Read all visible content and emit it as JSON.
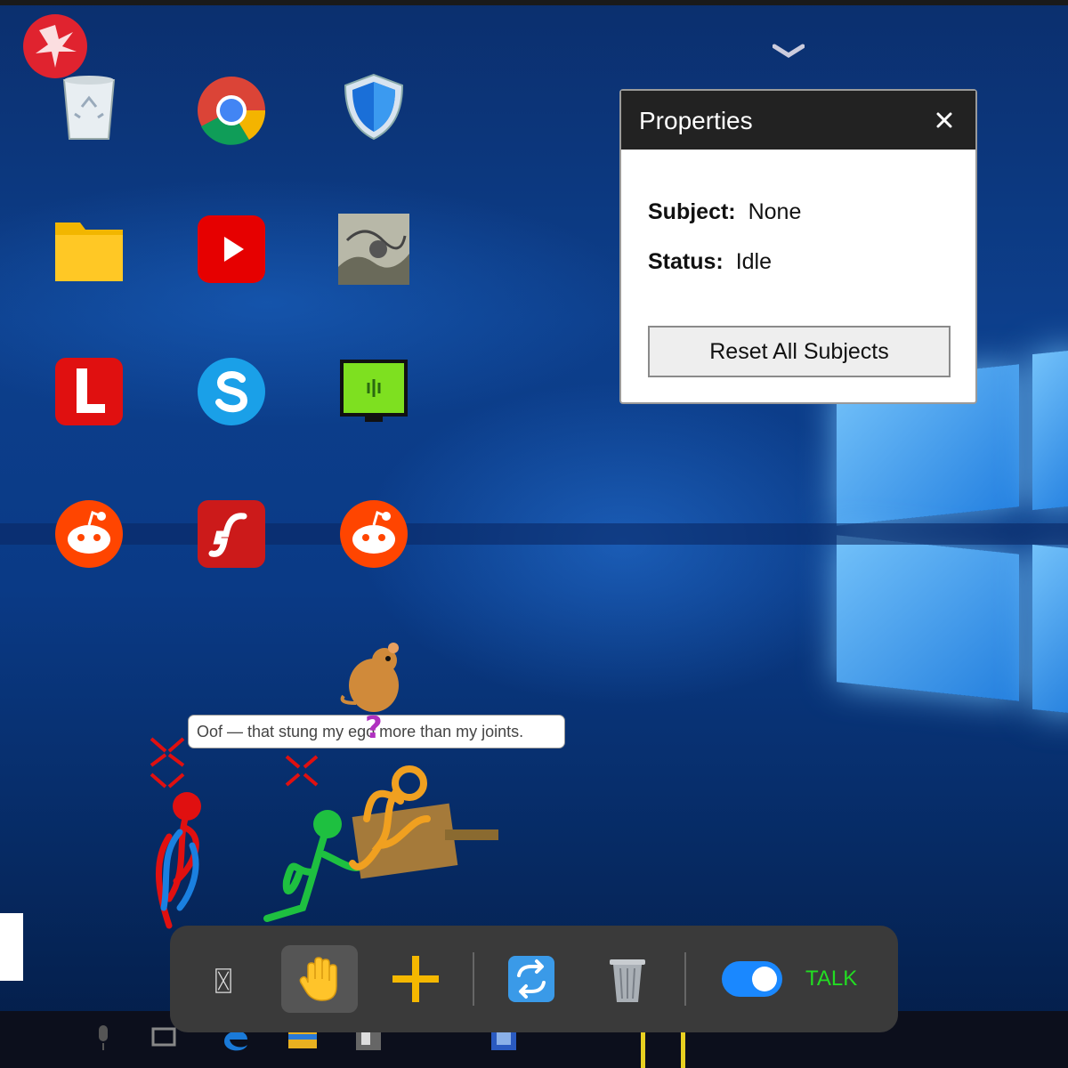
{
  "properties_panel": {
    "title": "Properties",
    "close_glyph": "✕",
    "subject_label": "Subject:",
    "subject_value": "None",
    "status_label": "Status:",
    "status_value": "Idle",
    "reset_button": "Reset All Subjects"
  },
  "speech_bubble": {
    "text": "Oof — that stung my ego more than my joints."
  },
  "toolbar": {
    "unknown_glyph": "〿",
    "tools": [
      "select-unknown-icon",
      "hand-icon",
      "add-icon",
      "swap-icon",
      "trash-icon"
    ],
    "talk_toggle_on": true,
    "talk_label": "TALK"
  },
  "desktop_icons": [
    "recycle-bin",
    "chrome",
    "shield",
    "folder",
    "youtube",
    "photo",
    "letter-l",
    "skype",
    "green-monitor",
    "reddit",
    "flash",
    "reddit"
  ],
  "colors": {
    "panel_header": "#222222",
    "toolbar_bg": "#3a3a3a",
    "talk_green": "#22dd22",
    "toggle_blue": "#1a88ff"
  }
}
